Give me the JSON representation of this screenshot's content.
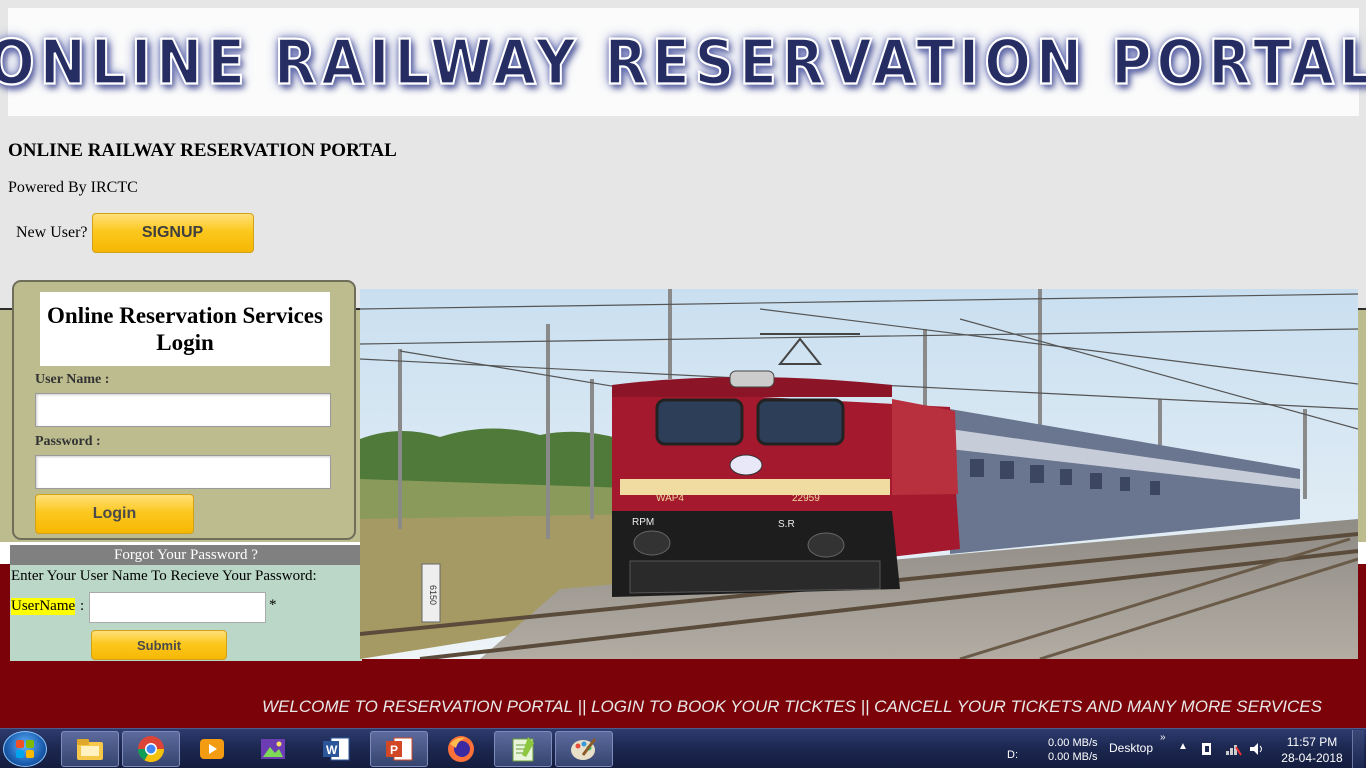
{
  "banner": {
    "title": "ONLINE RAILWAY RESERVATION PORTAL"
  },
  "header": {
    "heading": "ONLINE RAILWAY RESERVATION PORTAL",
    "powered_by": "Powered By IRCTC",
    "new_user_label": "New User?",
    "signup_label": "SIGNUP"
  },
  "login": {
    "title": "Online Reservation Services Login",
    "username_label": "User Name :",
    "username_value": "",
    "password_label": "Password :",
    "password_value": "",
    "login_label": "Login"
  },
  "forgot": {
    "header": "Forgot Your Password ?",
    "instruction": "Enter Your User Name To Recieve Your Password:",
    "username_label": "UserName",
    "username_colon": ":",
    "username_value": "",
    "required_mark": "*",
    "submit_label": "Submit"
  },
  "train_image": {
    "locomotive_text": "WAP4",
    "locomotive_number": "22959",
    "shed_left": "RPM",
    "shed_right": "S.R",
    "pole_marker": "6150"
  },
  "marquee": {
    "text": "WELCOME TO RESERVATION PORTAL || LOGIN TO BOOK YOUR TICKTES || CANCELL YOUR TICKETS AND MANY MORE SERVICES"
  },
  "taskbar": {
    "apps": [
      {
        "icon": "file-explorer-icon"
      },
      {
        "icon": "chrome-icon"
      },
      {
        "icon": "media-player-icon"
      },
      {
        "icon": "photo-viewer-icon"
      },
      {
        "icon": "word-icon"
      },
      {
        "icon": "powerpoint-icon"
      },
      {
        "icon": "firefox-icon"
      },
      {
        "icon": "notepad-plus-plus-icon"
      },
      {
        "icon": "paint-icon"
      }
    ],
    "drive": "D:",
    "upload_speed": "0.00 MB/s",
    "download_speed": "0.00 MB/s",
    "desktop_label": "Desktop",
    "time": "11:57 PM",
    "date": "28-04-2018"
  },
  "colors": {
    "olive": "#bcbc8f",
    "maroon": "#7a0208",
    "gold_button": "#fcc81f",
    "forgot_box": "#bad7c8",
    "banner_text": "#262d63"
  }
}
